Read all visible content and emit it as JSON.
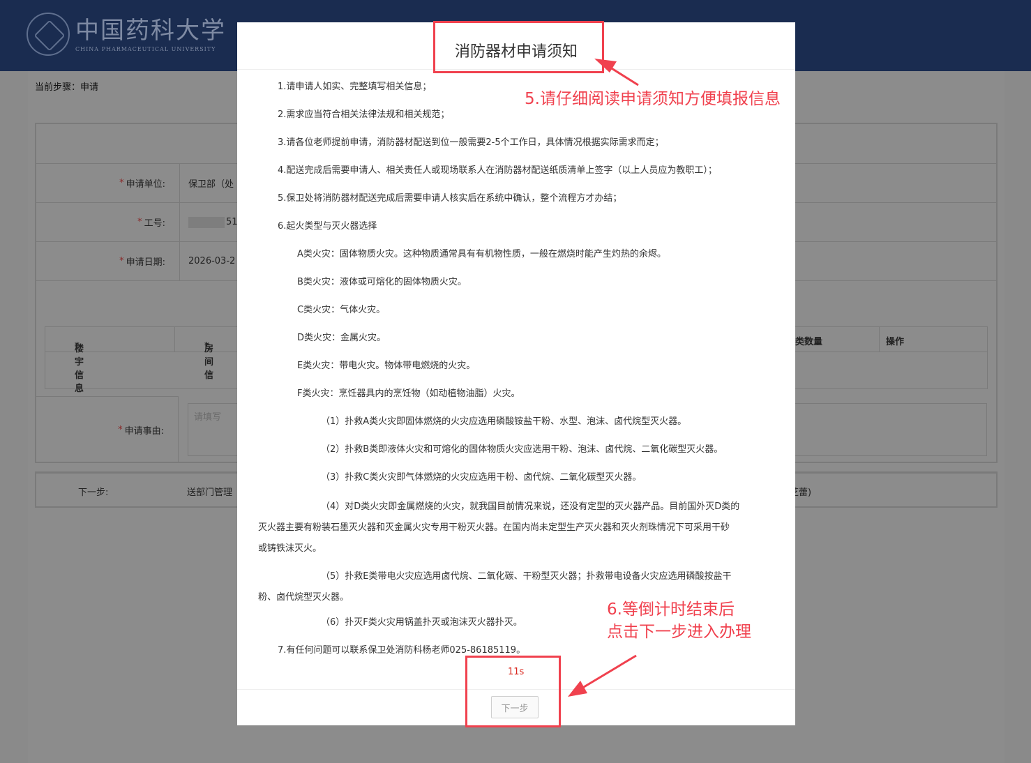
{
  "header": {
    "logo_cn": "中国药科大学",
    "logo_en": "CHINA PHARMACEUTICAL UNIVERSITY"
  },
  "page": {
    "current_step": "当前步骤：申请",
    "fields": {
      "unit_label": "申请单位:",
      "unit_value": "保卫部（处",
      "id_label": "工号:",
      "id_value": "51",
      "date_label": "申请日期:",
      "date_value": "2026-03-2",
      "reason_label": "申请事由:",
      "reason_placeholder": "请填写"
    },
    "table": {
      "col_building": "楼宇信息",
      "col_room": "房间信",
      "col_count": "类数量",
      "col_ops": "操作"
    },
    "next": {
      "label": "下一步:",
      "value": "送部门管理",
      "value_tail": "芝蕾)"
    }
  },
  "modal": {
    "title": "消防器材申请须知",
    "items": [
      "1.请申请人如实、完整填写相关信息；",
      "2.需求应当符合相关法律法规和相关规范；",
      "3.请各位老师提前申请，消防器材配送到位一般需要2-5个工作日，具体情况根据实际需求而定；",
      "4.配送完成后需要申请人、相关责任人或现场联系人在消防器材配送纸质清单上签字（以上人员应为教职工）；",
      "5.保卫处将消防器材配送完成后需要申请人核实后在系统中确认，整个流程方才办结；",
      "6.起火类型与灭火器选择"
    ],
    "fire_types": [
      "A类火灾：固体物质火灾。这种物质通常具有有机物性质，一般在燃烧时能产生灼热的余烬。",
      "B类火灾：液体或可熔化的固体物质火灾。",
      "C类火灾：气体火灾。",
      "D类火灾：金属火灾。",
      "E类火灾：带电火灾。物体带电燃烧的火灾。",
      "F类火灾：烹饪器具内的烹饪物（如动植物油脂）火灾。"
    ],
    "rules": [
      "（1）扑救A类火灾即固体燃烧的火灾应选用磷酸铵盐干粉、水型、泡沫、卤代烷型灭火器。",
      "（2）扑救B类即液体火灾和可熔化的固体物质火灾应选用干粉、泡沫、卤代烷、二氧化碳型灭火器。",
      "（3）扑救C类火灾即气体燃烧的火灾应选用干粉、卤代烷、二氧化碳型灭火器。"
    ],
    "rule4_l1": "（4）对D类火灾即金属燃烧的火灾，就我国目前情况来说，还没有定型的灭火器产品。目前国外灭D类的",
    "rule4_l2": "灭火器主要有粉装石墨灭火器和灭金属火灾专用干粉灭火器。在国内尚未定型生产灭火器和灭火剂珠情况下可采用干砂",
    "rule4_l3": "或铸铁沫灭火。",
    "rule5_l1": "（5）扑救E类带电火灾应选用卤代烷、二氧化碳、干粉型灭火器；扑救带电设备火灾应选用磷酸按盐干",
    "rule5_l2": "粉、卤代烷型灭火器。",
    "rule6": "（6）扑灭F类火灾用锅盖扑灭或泡沫灭火器扑灭。",
    "item7": "7.有任何问题可以联系保卫处消防科杨老师025-86185119。",
    "countdown": "11s",
    "next_button": "下一步"
  },
  "annotations": {
    "note5": "5.请仔细阅读申请须知方便填报信息",
    "note6_l1": "6.等倒计时结束后",
    "note6_l2": "点击下一步进入办理",
    "color": "#f0414e"
  }
}
